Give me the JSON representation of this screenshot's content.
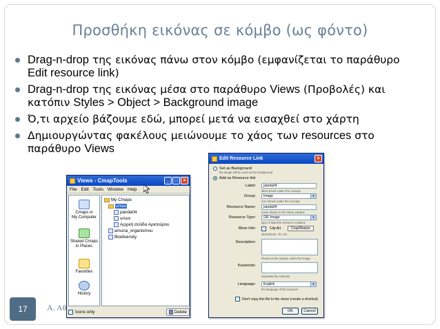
{
  "slide": {
    "title": "Προσθήκη εικόνας σε κόμβο (ως φόντο)",
    "number": "17",
    "author": "Α. Αθ",
    "bullets": [
      [
        "Drag-n-drop",
        " της εικόνας πάνω στον κόμβο (εμφανίζεται το παράθυρο ",
        "Edit resource link",
        ")"
      ],
      [
        "Drag-n-drop",
        " της εικόνας μέσα στο παράθυρο ",
        "Views",
        " (Προβολές) και κατόπιν ",
        "Styles > Object > Background image",
        ""
      ],
      [
        "Ό,τι αρχείο βάζουμε εδώ, μπορεί μετά να εισαχθεί στο χάρτη",
        "",
        "",
        ""
      ],
      [
        "Δημιουργώντας φακέλους μειώνουμε το χάος των ",
        "resources",
        " στο παράθυρο ",
        "Views"
      ]
    ]
  },
  "views_window": {
    "title": "Views - CmapTools",
    "menu": [
      "File",
      "Edit",
      "Tools",
      "Window",
      "Help"
    ],
    "side": [
      {
        "label1": "Cmaps in",
        "label2": "My Computer",
        "icon": "computer-icon"
      },
      {
        "label1": "Shared Cmaps",
        "label2": "in Places",
        "icon": "places-icon"
      },
      {
        "label1": "Favorites",
        "label2": "",
        "icon": "star-icon"
      },
      {
        "label1": "History",
        "label2": "",
        "icon": "clock-icon"
      }
    ],
    "tree": [
      "My Cmaps",
      "ursus",
      "panda04",
      "ursus",
      "Αρχική σελίδα Αρκτούρου",
      "amuna_organismou",
      "Biodiversity"
    ],
    "icons_only": "Icons only",
    "delete": "Delete"
  },
  "dialog": {
    "title": "Edit Resource Link",
    "opt1": "Set as Background",
    "opt1_note": "the image will be used as the background",
    "opt2": "Add as Resource link",
    "label": "Label:",
    "label_val": "panda04",
    "label_note": "label shown under the concept",
    "group": "Group:",
    "group_val": "Image",
    "group_note": "icon shown under the concept",
    "res_name": "Resource Name:",
    "res_name_val": "panda04",
    "res_name_note": "name shown in the Views window",
    "res_type": "Resource Type:",
    "res_type_val": "GIF Image",
    "res_type_note": "type of data this resource contains",
    "more_info": "More Info:",
    "clip_art": "Clip Art",
    "crop_resize": "Crop/Resize",
    "dims": "dimensions: 75 x 81",
    "desc": "Description:",
    "desc_note": "shown as the caption under the image",
    "keywords": "Keywords:",
    "keywords_note": "separated by commas",
    "language": "Language:",
    "language_val": "English",
    "language_note": "the language of the resource",
    "dont_copy": "Don't copy this file to the views (create a shortcut)",
    "ok": "OK",
    "cancel": "Cancel"
  }
}
